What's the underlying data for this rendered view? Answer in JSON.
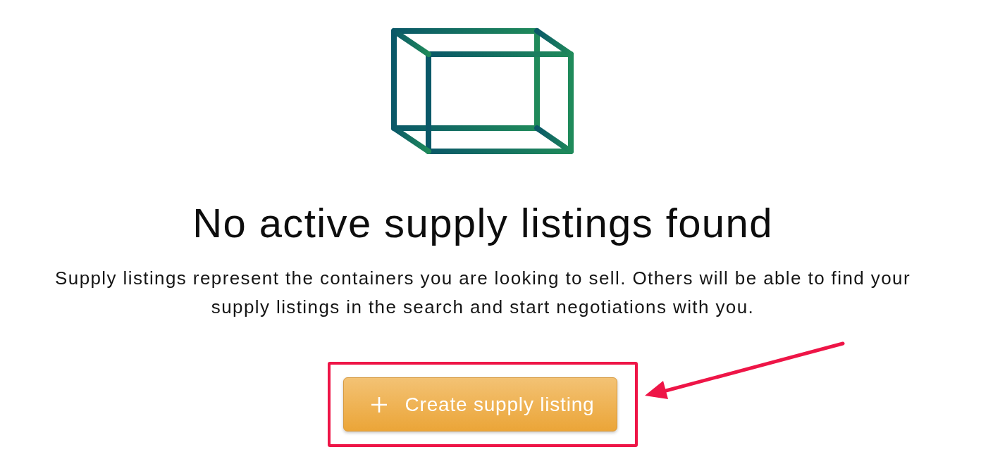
{
  "empty_state": {
    "title": "No active supply listings found",
    "description": "Supply listings represent the containers you are looking to sell. Others will be able to find your supply listings in the search and start negotiations with you.",
    "action": {
      "label": "Create supply listing"
    }
  },
  "annotation": {
    "highlight_frame": true,
    "arrow": true
  }
}
